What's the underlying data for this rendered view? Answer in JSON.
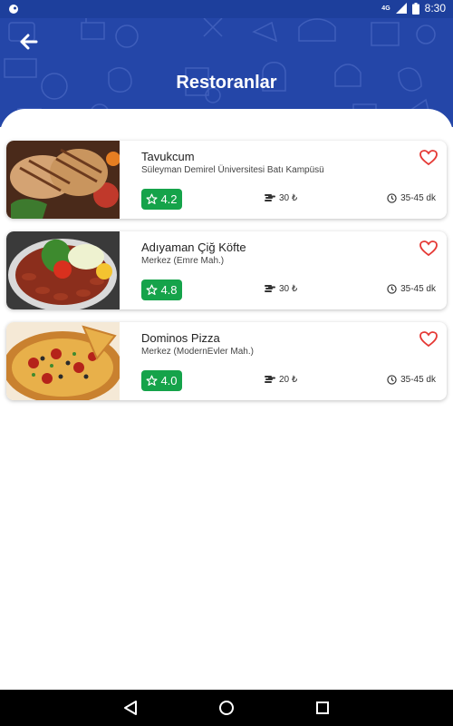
{
  "status_bar": {
    "network": "4G",
    "time": "8:30"
  },
  "header": {
    "title": "Restoranlar"
  },
  "colors": {
    "primary": "#2446a8",
    "rating_green": "#15a34a",
    "heart_red": "#e53935"
  },
  "restaurants": [
    {
      "name": "Tavukcum",
      "address": "Süleyman Demirel Üniversitesi Batı Kampüsü",
      "rating": "4.2",
      "price": "30 ₺",
      "time": "35-45 dk",
      "image": "grilled-chicken"
    },
    {
      "name": "Adıyaman Çiğ Köfte",
      "address": "Merkez (Emre Mah.)",
      "rating": "4.8",
      "price": "30 ₺",
      "time": "35-45 dk",
      "image": "cig-kofte"
    },
    {
      "name": "Dominos Pizza",
      "address": "Merkez (ModernEvler Mah.)",
      "rating": "4.0",
      "price": "20 ₺",
      "time": "35-45 dk",
      "image": "pizza"
    }
  ]
}
